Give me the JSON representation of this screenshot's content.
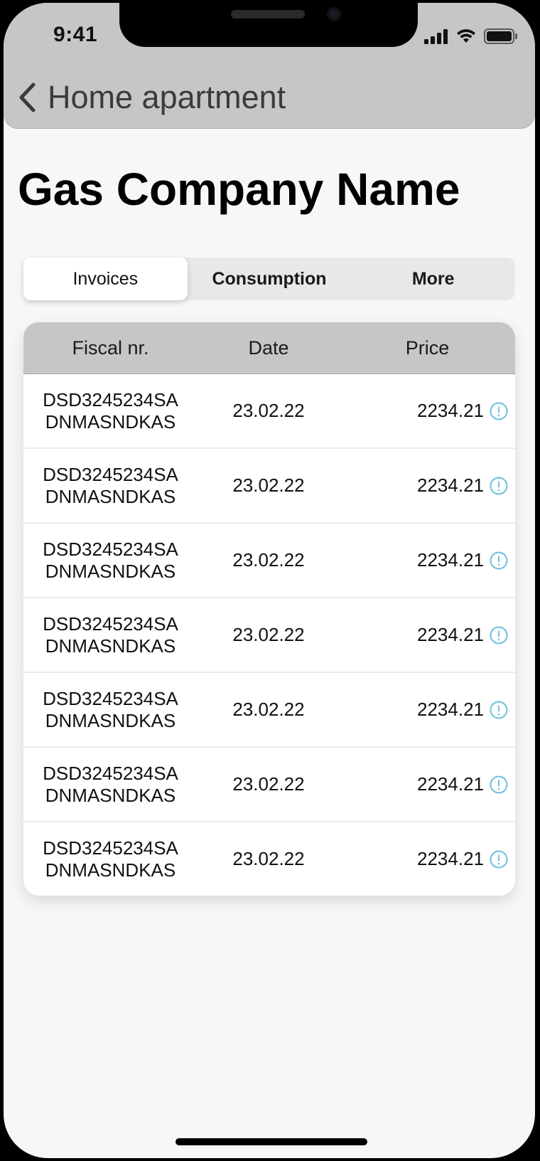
{
  "status_bar": {
    "time": "9:41"
  },
  "nav": {
    "back_icon": "chevron-left-icon",
    "title": "Home apartment"
  },
  "page": {
    "title": "Gas Company Name"
  },
  "tabs": [
    {
      "label": "Invoices",
      "active": true
    },
    {
      "label": "Consumption",
      "active": false
    },
    {
      "label": "More",
      "active": false
    }
  ],
  "table": {
    "headers": {
      "fiscal": "Fiscal nr.",
      "date": "Date",
      "price": "Price"
    },
    "rows": [
      {
        "fiscal_line1": "DSD3245234SA",
        "fiscal_line2": "DNMASNDKAS",
        "date": "23.02.22",
        "price": "2234.21"
      },
      {
        "fiscal_line1": "DSD3245234SA",
        "fiscal_line2": "DNMASNDKAS",
        "date": "23.02.22",
        "price": "2234.21"
      },
      {
        "fiscal_line1": "DSD3245234SA",
        "fiscal_line2": "DNMASNDKAS",
        "date": "23.02.22",
        "price": "2234.21"
      },
      {
        "fiscal_line1": "DSD3245234SA",
        "fiscal_line2": "DNMASNDKAS",
        "date": "23.02.22",
        "price": "2234.21"
      },
      {
        "fiscal_line1": "DSD3245234SA",
        "fiscal_line2": "DNMASNDKAS",
        "date": "23.02.22",
        "price": "2234.21"
      },
      {
        "fiscal_line1": "DSD3245234SA",
        "fiscal_line2": "DNMASNDKAS",
        "date": "23.02.22",
        "price": "2234.21"
      },
      {
        "fiscal_line1": "DSD3245234SA",
        "fiscal_line2": "DNMASNDKAS",
        "date": "23.02.22",
        "price": "2234.21"
      }
    ]
  },
  "colors": {
    "header_bg": "#c6c6c6",
    "page_bg": "#f6f7f7",
    "info_icon": "#6cc0e0"
  }
}
